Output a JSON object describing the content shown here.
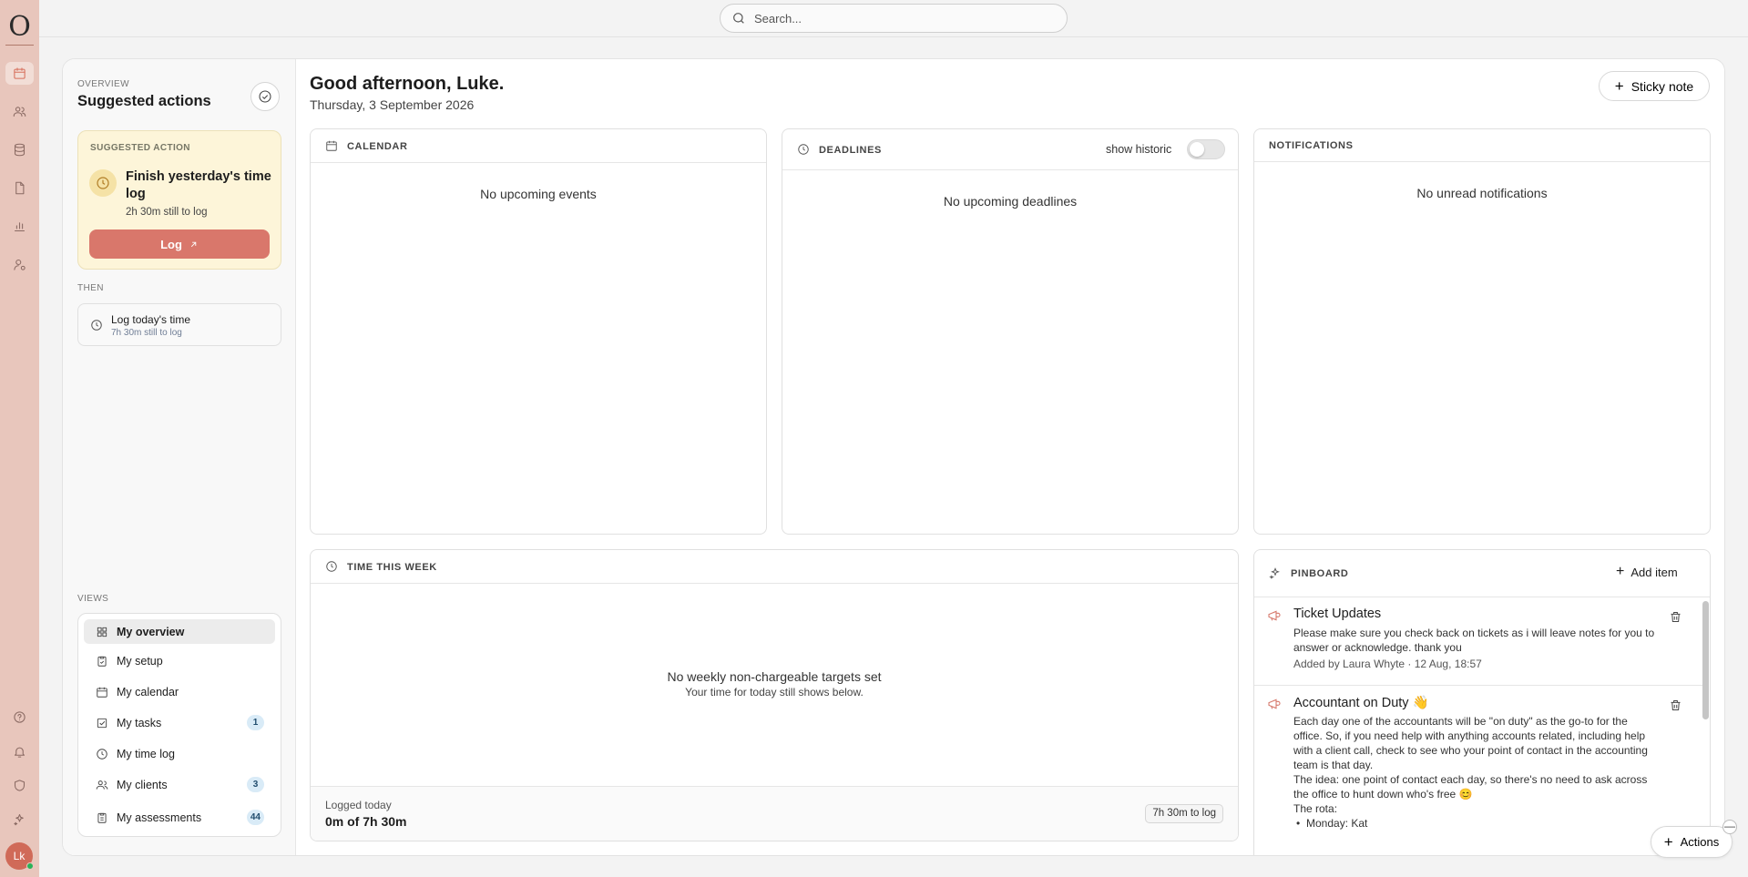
{
  "app": {
    "logo_letter": "O",
    "avatar_initials": "Lk"
  },
  "search": {
    "placeholder": "Search..."
  },
  "rail": {
    "icons": [
      "calendar-icon",
      "users-icon",
      "database-icon",
      "document-icon",
      "bar-chart-icon",
      "user-cog-icon",
      "help-icon",
      "bell-icon",
      "shield-icon",
      "sparkle-icon"
    ]
  },
  "sidebar": {
    "eyebrow": "OVERVIEW",
    "title": "Suggested actions",
    "suggested": {
      "eyebrow": "SUGGESTED ACTION",
      "title": "Finish yesterday's time log",
      "subtitle": "2h 30m still to log",
      "button": "Log"
    },
    "then_label": "THEN",
    "next": {
      "title": "Log today's time",
      "subtitle": "7h 30m still to log"
    },
    "views_label": "VIEWS",
    "views": [
      {
        "label": "My overview",
        "active": true
      },
      {
        "label": "My setup"
      },
      {
        "label": "My calendar"
      },
      {
        "label": "My tasks",
        "badge": "1"
      },
      {
        "label": "My time log"
      },
      {
        "label": "My clients",
        "badge": "3"
      },
      {
        "label": "My assessments",
        "badge": "44"
      }
    ]
  },
  "header": {
    "greeting": "Good afternoon, Luke.",
    "date": "Thursday, 3 September 2026",
    "sticky_button": "Sticky note"
  },
  "calendar": {
    "title": "CALENDAR",
    "empty": "No upcoming events"
  },
  "deadlines": {
    "title": "DEADLINES",
    "toggle_label": "show historic",
    "toggle_on": false,
    "empty": "No upcoming deadlines"
  },
  "notifications": {
    "title": "NOTIFICATIONS",
    "empty": "No unread notifications"
  },
  "time_week": {
    "title": "TIME THIS WEEK",
    "empty_title": "No weekly non-chargeable targets set",
    "empty_sub": "Your time for today still shows below.",
    "logged_label": "Logged today",
    "logged_value": "0m of 7h 30m",
    "to_log": "7h 30m to log"
  },
  "pinboard": {
    "title": "PINBOARD",
    "add_button": "Add item",
    "items": [
      {
        "title": "Ticket Updates",
        "body": "Please make sure you check back on tickets as i will leave notes for you to answer or acknowledge. thank you",
        "meta": "Added by Laura Whyte · 12 Aug, 18:57"
      },
      {
        "title": "Accountant on Duty 👋",
        "body": "Each day one of the accountants will be \"on duty\" as the go-to for the office. So, if you need help with anything accounts related, including help with a client call, check to see who your point of contact in the accounting team is that day.",
        "body2": "The idea: one point of contact each day, so there's no need to ask across the office to hunt down who's free 😊",
        "body3": "The rota:",
        "bullet1": "Monday: Kat"
      }
    ]
  },
  "actions": {
    "label": "Actions",
    "minimize": "—"
  }
}
